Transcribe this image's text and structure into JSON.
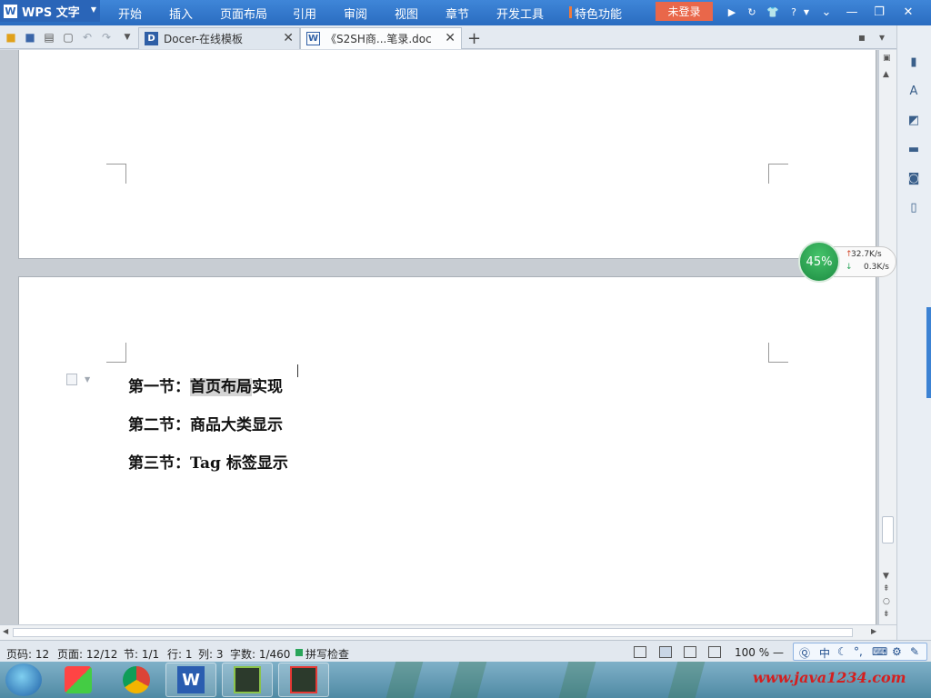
{
  "app": {
    "name": "WPS 文字"
  },
  "menu": {
    "tabs": [
      "开始",
      "插入",
      "页面布局",
      "引用",
      "审阅",
      "视图",
      "章节",
      "开发工具",
      "特色功能"
    ],
    "login_label": "未登录",
    "help_label": "?"
  },
  "tabs": [
    {
      "label": "Docer-在线模板",
      "icon": "docer-icon"
    },
    {
      "label": "《S2SH商...笔录.doc",
      "icon": "word-doc-icon"
    }
  ],
  "document": {
    "lines": [
      {
        "prefix": "第一节：",
        "selected": "首页布局",
        "rest": "实现"
      },
      {
        "text": "第二节：商品大类显示"
      },
      {
        "text": "第三节：Tag 标签显示"
      }
    ]
  },
  "net_widget": {
    "percent": "45%",
    "upload": "32.7K/s",
    "download": "0.3K/s"
  },
  "status": {
    "page_code": "页码: 12",
    "page": "页面: 12/12",
    "section": "节: 1/1",
    "row": "行: 1",
    "col": "列: 3",
    "word_count": "字数: 1/460",
    "spell_check": "拼写检查",
    "zoom": "100 %"
  },
  "ime": {
    "lang": "中"
  },
  "taskbar": {
    "watermark": "www.java1234.com"
  },
  "colors": {
    "menubar": "#2f74c8",
    "login": "#e9674a",
    "spell_ok": "#2aa55a",
    "watermark": "#d41f1f"
  }
}
